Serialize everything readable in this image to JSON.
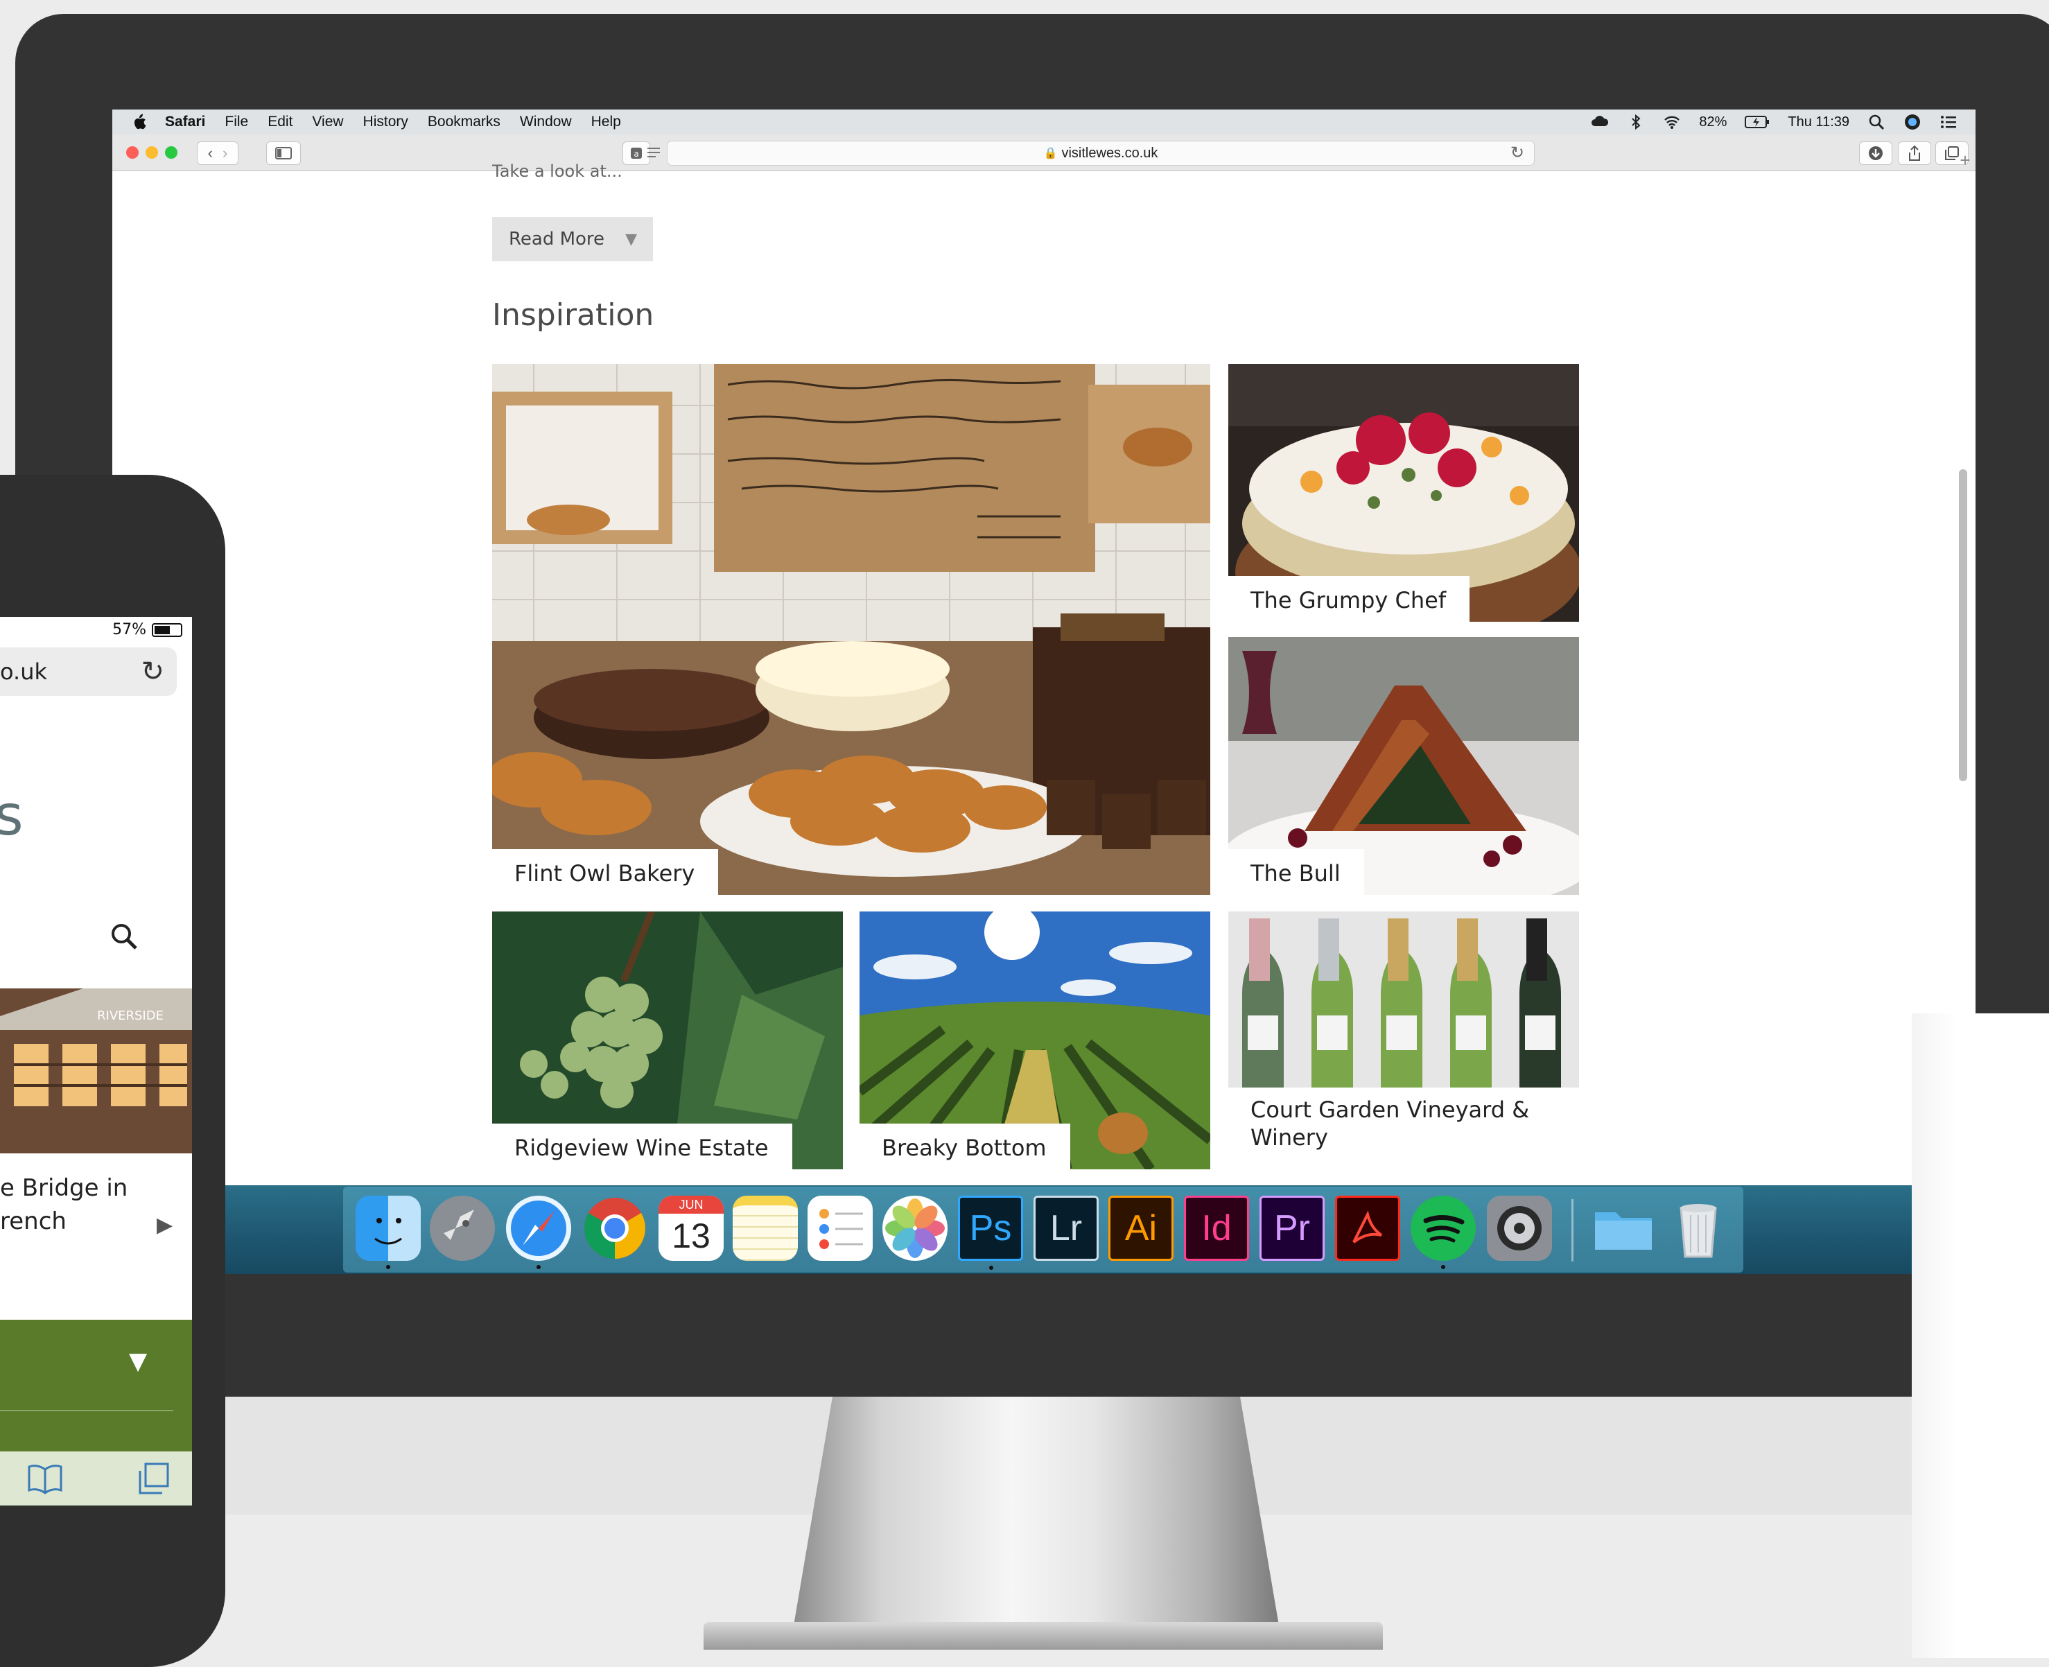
{
  "menubar": {
    "app": "Safari",
    "items": [
      "File",
      "Edit",
      "View",
      "History",
      "Bookmarks",
      "Window",
      "Help"
    ],
    "battery": "82%",
    "clock": "Thu 11:39"
  },
  "toolbar": {
    "url": "visitlewes.co.uk"
  },
  "page": {
    "cut_text": "Take a look at...",
    "read_more": "Read More",
    "section_title": "Inspiration",
    "tiles": [
      {
        "caption": "Flint Owl Bakery"
      },
      {
        "caption": "The Grumpy Chef"
      },
      {
        "caption": "The Bull"
      },
      {
        "caption": "Ridgeview Wine Estate"
      },
      {
        "caption": "Breaky Bottom"
      },
      {
        "caption": "Court Garden Vineyard & Winery"
      }
    ]
  },
  "dock": {
    "apps": [
      "Finder",
      "Launchpad",
      "Safari",
      "Chrome",
      "Calendar",
      "Notes",
      "Reminders",
      "Photos",
      "Photoshop",
      "Lightroom",
      "Illustrator",
      "InDesign",
      "Premiere Pro",
      "Acrobat",
      "Spotify",
      "System Preferences",
      "Folder",
      "Trash"
    ],
    "calendar_month": "JUN",
    "calendar_day": "13",
    "labels": {
      "ps": "Ps",
      "lr": "Lr",
      "ai": "Ai",
      "id": "Id",
      "pr": "Pr"
    }
  },
  "phone": {
    "battery": "57%",
    "url": "o.uk",
    "logo_fragment": "s",
    "text_line1": "e Bridge in",
    "text_line2": "rench",
    "sign": "RIVERSIDE"
  }
}
